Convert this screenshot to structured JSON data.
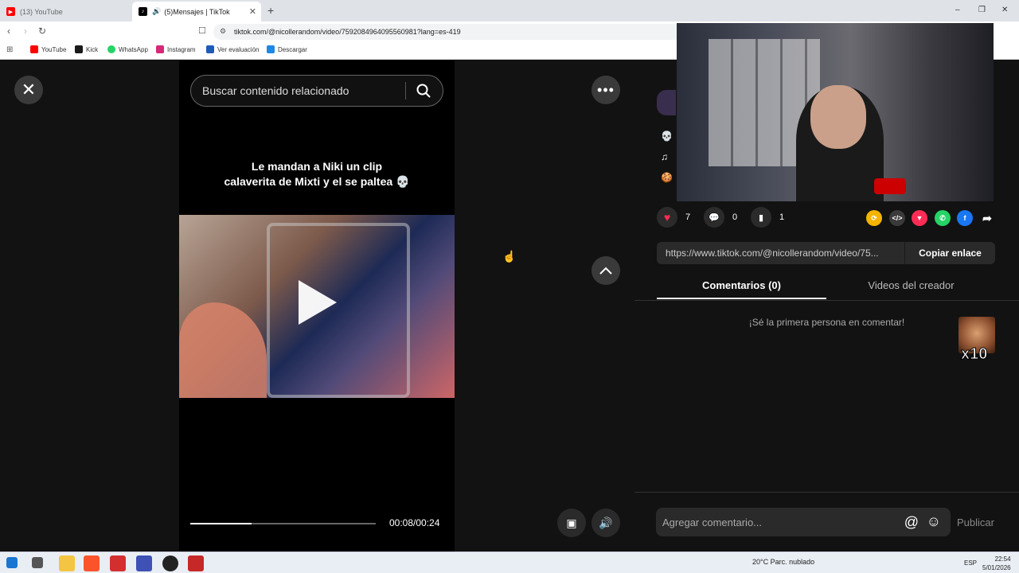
{
  "browser": {
    "tabs": [
      {
        "label": "(13) YouTube",
        "active": false,
        "favicon": "youtube-icon",
        "color": "#ff0000"
      },
      {
        "label": "(5)Mensajes | TikTok",
        "active": true,
        "favicon": "tiktok-icon",
        "color": "#000000"
      }
    ],
    "new_tab": "+",
    "url": "tiktok.com/@nicollerandom/video/7592084964095560981?lang=es-419",
    "window_controls": [
      "–",
      "❐",
      "✕"
    ],
    "bookmarks": [
      {
        "label": "YouTube",
        "color": "#ff0000"
      },
      {
        "label": "Kick",
        "color": "#1a1a1a"
      },
      {
        "label": "WhatsApp",
        "color": "#25d366"
      },
      {
        "label": "Instagram",
        "color": "#d62976"
      },
      {
        "label": "Ver evaluación",
        "color": "#1e5bb8"
      },
      {
        "label": "Descargar",
        "color": "#1e88e5"
      }
    ]
  },
  "player": {
    "close": "✕",
    "search_placeholder": "Buscar contenido relacionado",
    "caption_line1": "Le mandan a Niki un clip",
    "caption_line2": "calaverita de Mixti y el se paltea 💀",
    "progress": 0.33,
    "time": "00:08/00:24",
    "more": "•••",
    "up": "︿"
  },
  "details": {
    "side_icons": [
      "💀",
      "♫",
      "🍪"
    ],
    "likes": "7",
    "comments": "0",
    "saves": "1",
    "share_colors": [
      "#f5b400",
      "#3a3a3a",
      "#fe2c55",
      "#25d366",
      "#1877f2"
    ],
    "link": "https://www.tiktok.com/@nicollerandom/video/75...",
    "copy_label": "Copiar enlace",
    "tab_comments": "Comentarios (0)",
    "tab_videos": "Videos del creador",
    "empty_comments": "¡Sé la primera persona en comentar!",
    "emote_label": "x10",
    "comment_placeholder": "Agregar comentario...",
    "at": "@",
    "emoji": "☺",
    "publish": "Publicar"
  },
  "taskbar": {
    "weather": "20°C  Parc. nublado",
    "lang": "ESP",
    "time": "22:54",
    "date": "5/01/2026"
  }
}
